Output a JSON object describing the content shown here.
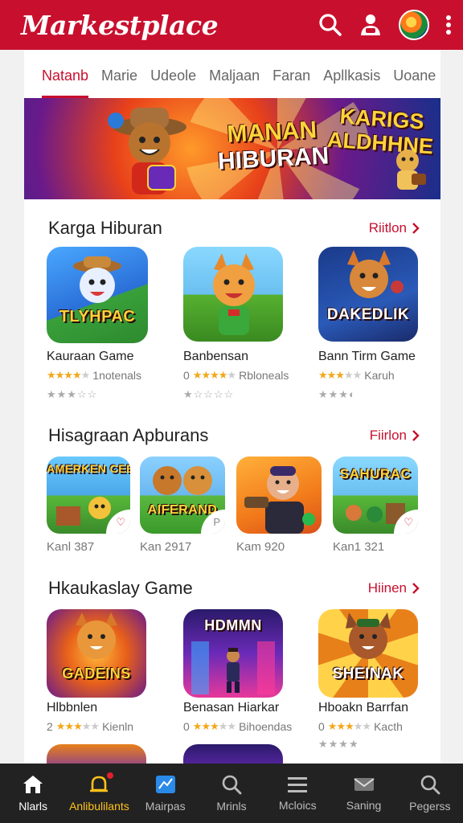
{
  "app": {
    "title": "Markestplace"
  },
  "header_icons": [
    "search-icon",
    "profile-icon",
    "avatar",
    "more-vert-icon"
  ],
  "tabs": [
    {
      "label": "Natanb",
      "active": true
    },
    {
      "label": "Marie"
    },
    {
      "label": "Udeole"
    },
    {
      "label": "Maljaan"
    },
    {
      "label": "Faran"
    },
    {
      "label": "Apllkasis"
    },
    {
      "label": "Uoane"
    }
  ],
  "banner": {
    "line1a": "MANAN",
    "line1b": "HIBURAN",
    "line2a": "KARIGS",
    "line2b": "ALDHHNE"
  },
  "section1": {
    "title": "Karga Hiburan",
    "more": "Riitlon",
    "items": [
      {
        "tile_text": "TLYHPAC",
        "name": "Kauraan Game",
        "rating": 4,
        "rating_text": "1notenals"
      },
      {
        "tile_text": "",
        "name": "Banbensan",
        "rating_prefix": "0",
        "rating": 4,
        "rating_text": "Rbloneals"
      },
      {
        "tile_text": "DAKEDLIK",
        "name": "Bann Tirm Game",
        "rating": 3,
        "rating_text": "Karuh"
      }
    ]
  },
  "section2": {
    "title": "Hisagraan Apburans",
    "more": "Fiirlon",
    "items": [
      {
        "tile_text": "AMERKEN CEEHB'S",
        "count": "Kanl 387"
      },
      {
        "tile_text": "AIFERAND",
        "count": "Kan 2917"
      },
      {
        "tile_text": "",
        "count": "Kam 920"
      },
      {
        "tile_text": "SAHURAC",
        "count": "Kan1 321"
      }
    ]
  },
  "section3": {
    "title": "Hkaukaslay Game",
    "more": "Hiinen",
    "items": [
      {
        "tile_text": "GADEINS",
        "name": "Hlbbnlen",
        "rating_prefix": "2",
        "rating": 3,
        "rating_text": "Kienln"
      },
      {
        "tile_text": "HDMMN",
        "name": "Benasan Hiarkar",
        "rating_prefix": "0",
        "rating": 3,
        "rating_text": "Bihoendas"
      },
      {
        "tile_text": "SHEINAK",
        "name": "Hboakn Barrfan",
        "rating_prefix": "0",
        "rating": 3,
        "rating_text": "Kacth"
      }
    ]
  },
  "bottom_nav": [
    {
      "label": "Nlarls",
      "icon": "home-icon",
      "active": true
    },
    {
      "label": "Anlibulilants",
      "icon": "bell-icon",
      "highlight": true,
      "badge": true
    },
    {
      "label": "Mairpas",
      "icon": "map-icon"
    },
    {
      "label": "Mrinls",
      "icon": "search-icon"
    },
    {
      "label": "Mcloics",
      "icon": "list-icon"
    },
    {
      "label": "Saning",
      "icon": "mail-icon"
    },
    {
      "label": "Pegerss",
      "icon": "search-icon"
    }
  ],
  "colors": {
    "brand": "#c8102e",
    "nav_bg": "#222222",
    "highlight": "#ffc21a"
  }
}
